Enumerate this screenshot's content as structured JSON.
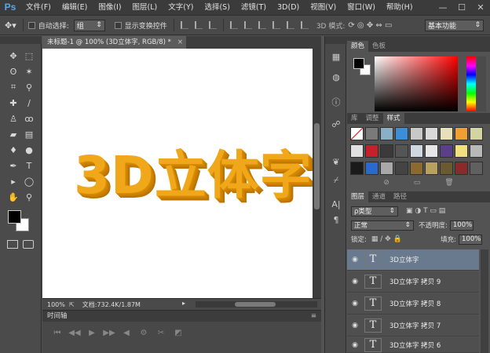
{
  "app": {
    "logo": "Ps",
    "menu": [
      "文件(F)",
      "编辑(E)",
      "图像(I)",
      "图层(L)",
      "文字(Y)",
      "选择(S)",
      "滤镜(T)",
      "3D(D)",
      "视图(V)",
      "窗口(W)",
      "帮助(H)"
    ],
    "window_controls": [
      "—",
      "☐",
      "✕"
    ]
  },
  "options": {
    "auto_select_label": "自动选择:",
    "auto_select_value": "组",
    "show_transform_label": "显示变换控件",
    "mode_label": "3D 模式:",
    "workspace": "基本功能"
  },
  "document": {
    "tab_title": "未标题-1 @ 100% (3D立体字, RGB/8) *",
    "art_text": "3D立体字",
    "zoom": "100%",
    "doc_size": "文档:732.4K/1.87M"
  },
  "timeline": {
    "title": "时间轴",
    "buttons": [
      "⏮",
      "◀◀",
      "▶",
      "▶▶",
      "◀",
      "⚙",
      "✂",
      "◩"
    ]
  },
  "color_panel": {
    "tabs": [
      "颜色",
      "色板"
    ],
    "foreground": "#000000",
    "background": "#ffffff"
  },
  "styles_panel": {
    "tabs": [
      "库",
      "调整",
      "样式"
    ],
    "footer_icons": [
      "⊘",
      "▭",
      "🗑"
    ]
  },
  "layers_panel": {
    "tabs": [
      "图层",
      "通道",
      "路径"
    ],
    "filter_kind": "ρ类型",
    "blend_mode": "正常",
    "opacity_label": "不透明度:",
    "opacity_value": "100%",
    "lock_label": "锁定:",
    "fill_label": "填充:",
    "fill_value": "100%",
    "layers": [
      {
        "name": "3D立体字",
        "selected": true
      },
      {
        "name": "3D立体字 拷贝 9",
        "selected": false
      },
      {
        "name": "3D立体字 拷贝 8",
        "selected": false
      },
      {
        "name": "3D立体字 拷贝 7",
        "selected": false
      },
      {
        "name": "3D立体字 拷贝 6",
        "selected": false
      }
    ]
  },
  "tools": [
    {
      "icon": "move-tool",
      "glyph": "✥"
    },
    {
      "icon": "marquee-tool",
      "glyph": "⬚"
    },
    {
      "icon": "lasso-tool",
      "glyph": "ʘ"
    },
    {
      "icon": "magic-wand-tool",
      "glyph": "✶"
    },
    {
      "icon": "crop-tool",
      "glyph": "⌗"
    },
    {
      "icon": "eyedropper-tool",
      "glyph": "⚲"
    },
    {
      "icon": "healing-tool",
      "glyph": "✚"
    },
    {
      "icon": "brush-tool",
      "glyph": "∕"
    },
    {
      "icon": "stamp-tool",
      "glyph": "♙"
    },
    {
      "icon": "history-brush-tool",
      "glyph": "ꝏ"
    },
    {
      "icon": "eraser-tool",
      "glyph": "▰"
    },
    {
      "icon": "gradient-tool",
      "glyph": "▤"
    },
    {
      "icon": "blur-tool",
      "glyph": "♦"
    },
    {
      "icon": "dodge-tool",
      "glyph": "●"
    },
    {
      "icon": "pen-tool",
      "glyph": "✒"
    },
    {
      "icon": "type-tool",
      "glyph": "T"
    },
    {
      "icon": "path-select-tool",
      "glyph": "▸"
    },
    {
      "icon": "ellipse-tool",
      "glyph": "◯"
    },
    {
      "icon": "hand-tool",
      "glyph": "✋"
    },
    {
      "icon": "zoom-tool",
      "glyph": "⚲"
    }
  ]
}
